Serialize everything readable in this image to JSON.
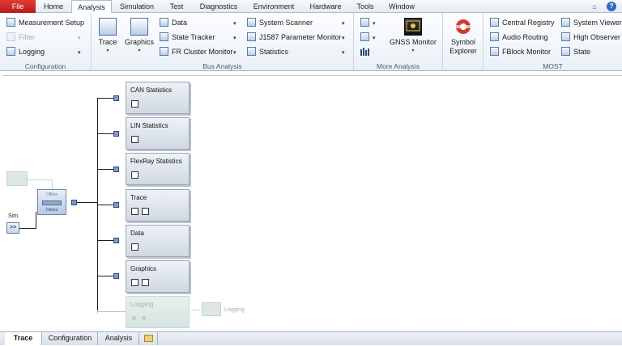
{
  "ribbon_tabs": [
    {
      "label": "File"
    },
    {
      "label": "Home"
    },
    {
      "label": "Analysis"
    },
    {
      "label": "Simulation"
    },
    {
      "label": "Test"
    },
    {
      "label": "Diagnostics"
    },
    {
      "label": "Environment"
    },
    {
      "label": "Hardware"
    },
    {
      "label": "Tools"
    },
    {
      "label": "Window"
    }
  ],
  "active_tab": "Analysis",
  "window_controls": {
    "restore": "⌂",
    "help": "?"
  },
  "groups": {
    "configuration": {
      "label": "Configuration",
      "items": [
        "Measurement Setup",
        "Filter",
        "Logging"
      ]
    },
    "bus_analysis": {
      "label": "Bus Analysis",
      "big_buttons": [
        "Trace",
        "Graphics"
      ],
      "col1": [
        "Data",
        "State Tracker",
        "FR Cluster Monitor"
      ],
      "col2": [
        "System Scanner",
        "J1587 Parameter Monitor",
        "Statistics"
      ]
    },
    "more_analysis": {
      "label": "More Analysis",
      "big_button": "GNSS Monitor"
    },
    "symbol": {
      "big_button_line1": "Symbol",
      "big_button_line2": "Explorer"
    },
    "most": {
      "label": "MOST",
      "col1": [
        "Central Registry",
        "Audio Routing",
        "FBlock Monitor"
      ],
      "col2": [
        "System Viewer",
        "High Observer",
        "State"
      ]
    }
  },
  "workspace": {
    "source_label": "Sim.",
    "source_button": ">>",
    "center_block_top": "Offline",
    "center_block_bottom": "Online",
    "blocks": [
      {
        "title": "CAN Statistics"
      },
      {
        "title": "LIN Statistics"
      },
      {
        "title": "FlexRay Statistics"
      },
      {
        "title": "Trace"
      },
      {
        "title": "Data"
      },
      {
        "title": "Graphics"
      },
      {
        "title": "Logging"
      }
    ],
    "logging_file_label": "Logging"
  },
  "bottom_tabs": [
    {
      "label": "Trace"
    },
    {
      "label": "Configuration"
    },
    {
      "label": "Analysis"
    }
  ],
  "active_bottom_tab": "Trace",
  "colors": {
    "file_tab": "#c8221d",
    "accent": "#2e6bc6"
  }
}
